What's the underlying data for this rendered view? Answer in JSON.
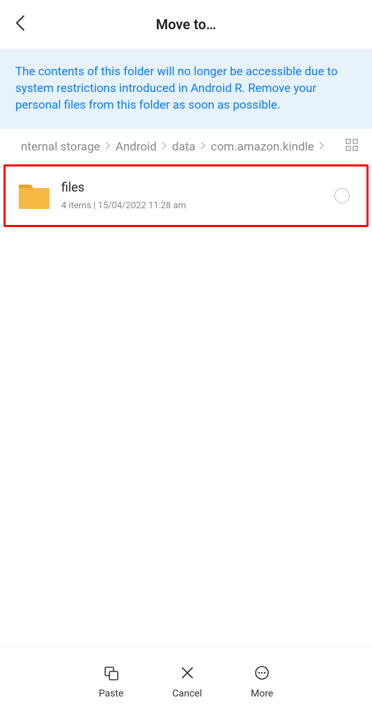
{
  "header": {
    "title": "Move to…"
  },
  "warning": "The contents of this folder will no longer be accessible due to system restrictions introduced in Android R. Remove your personal files from this folder as soon as possible.",
  "breadcrumb": {
    "items": [
      "nternal storage",
      "Android",
      "data",
      "com.amazon.kindle"
    ]
  },
  "files": [
    {
      "name": "files",
      "meta": "4 items  |  15/04/2022 11:28 am"
    }
  ],
  "bottomBar": {
    "paste": "Paste",
    "cancel": "Cancel",
    "more": "More"
  }
}
